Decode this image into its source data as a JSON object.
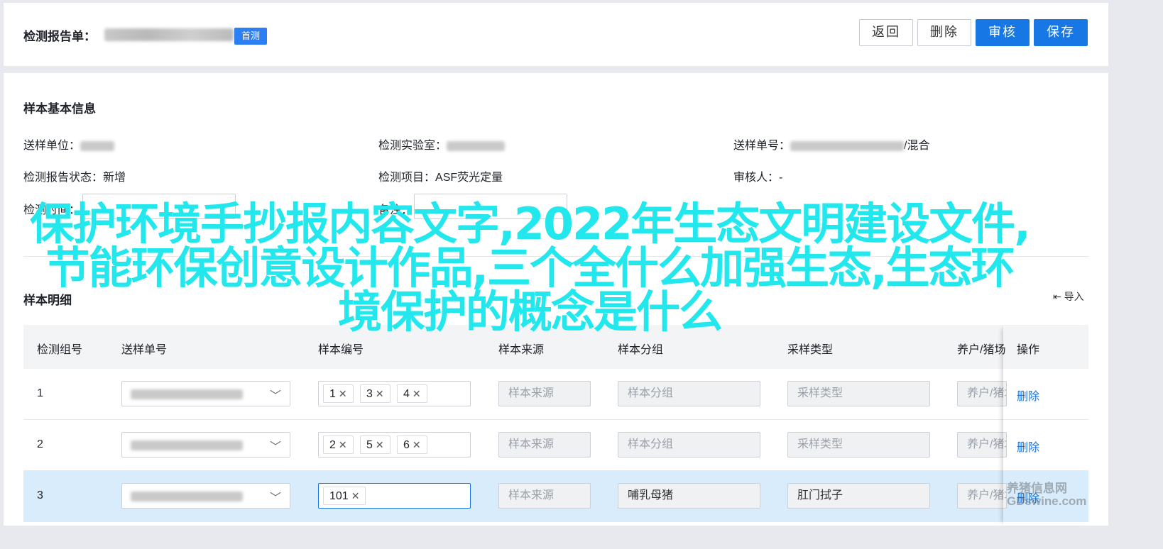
{
  "header": {
    "title": "检测报告单：",
    "badge": "首测",
    "buttons": {
      "back": "返回",
      "delete": "删除",
      "audit": "审核",
      "save": "保存"
    }
  },
  "basic": {
    "section_title": "样本基本信息",
    "fields": {
      "unit_label": "送样单位：",
      "lab_label": "检测实验室：",
      "order_label": "送样单号：",
      "order_suffix": "/混合",
      "status_label": "检测报告状态：",
      "status_value": "新增",
      "item_label": "检测项目：",
      "item_value": "ASF荧光定量",
      "auditor_label": "审核人：",
      "auditor_value": "-",
      "time_label": "检测时间：",
      "remark_label": "备注："
    }
  },
  "overlay_text": "保护环境手抄报内容文字,2022年生态文明建设文件,节能环保创意设计作品,三个全什么加强生态,生态环境保护的概念是什么",
  "detail": {
    "section_title": "样本明细",
    "import_label": "导入",
    "columns": [
      "检测组号",
      "送样单号",
      "样本编号",
      "样本来源",
      "样本分组",
      "采样类型",
      "养户/猪场",
      "操作"
    ],
    "rows": [
      {
        "group": "1",
        "tags": [
          "1",
          "3",
          "4"
        ],
        "source": "样本来源",
        "group_ph": "样本分组",
        "sample_type": "采样类型",
        "farm": "养户/猪场",
        "action": "删除"
      },
      {
        "group": "2",
        "tags": [
          "2",
          "5",
          "6"
        ],
        "source": "样本来源",
        "group_ph": "样本分组",
        "sample_type": "采样类型",
        "farm": "养户/猪场",
        "action": "删除"
      },
      {
        "group": "3",
        "tags": [
          "101"
        ],
        "source": "样本来源",
        "group_ph": "哺乳母猪",
        "sample_type": "肛门拭子",
        "farm": "养户/猪场",
        "action": "删除"
      }
    ]
  },
  "watermark": "养猪信息网 GDswine.com",
  "colors": {
    "primary": "#1677e5",
    "badge": "#2c7ef3",
    "overlay": "#22e8ee",
    "row_highlight": "#d8ecfb"
  }
}
